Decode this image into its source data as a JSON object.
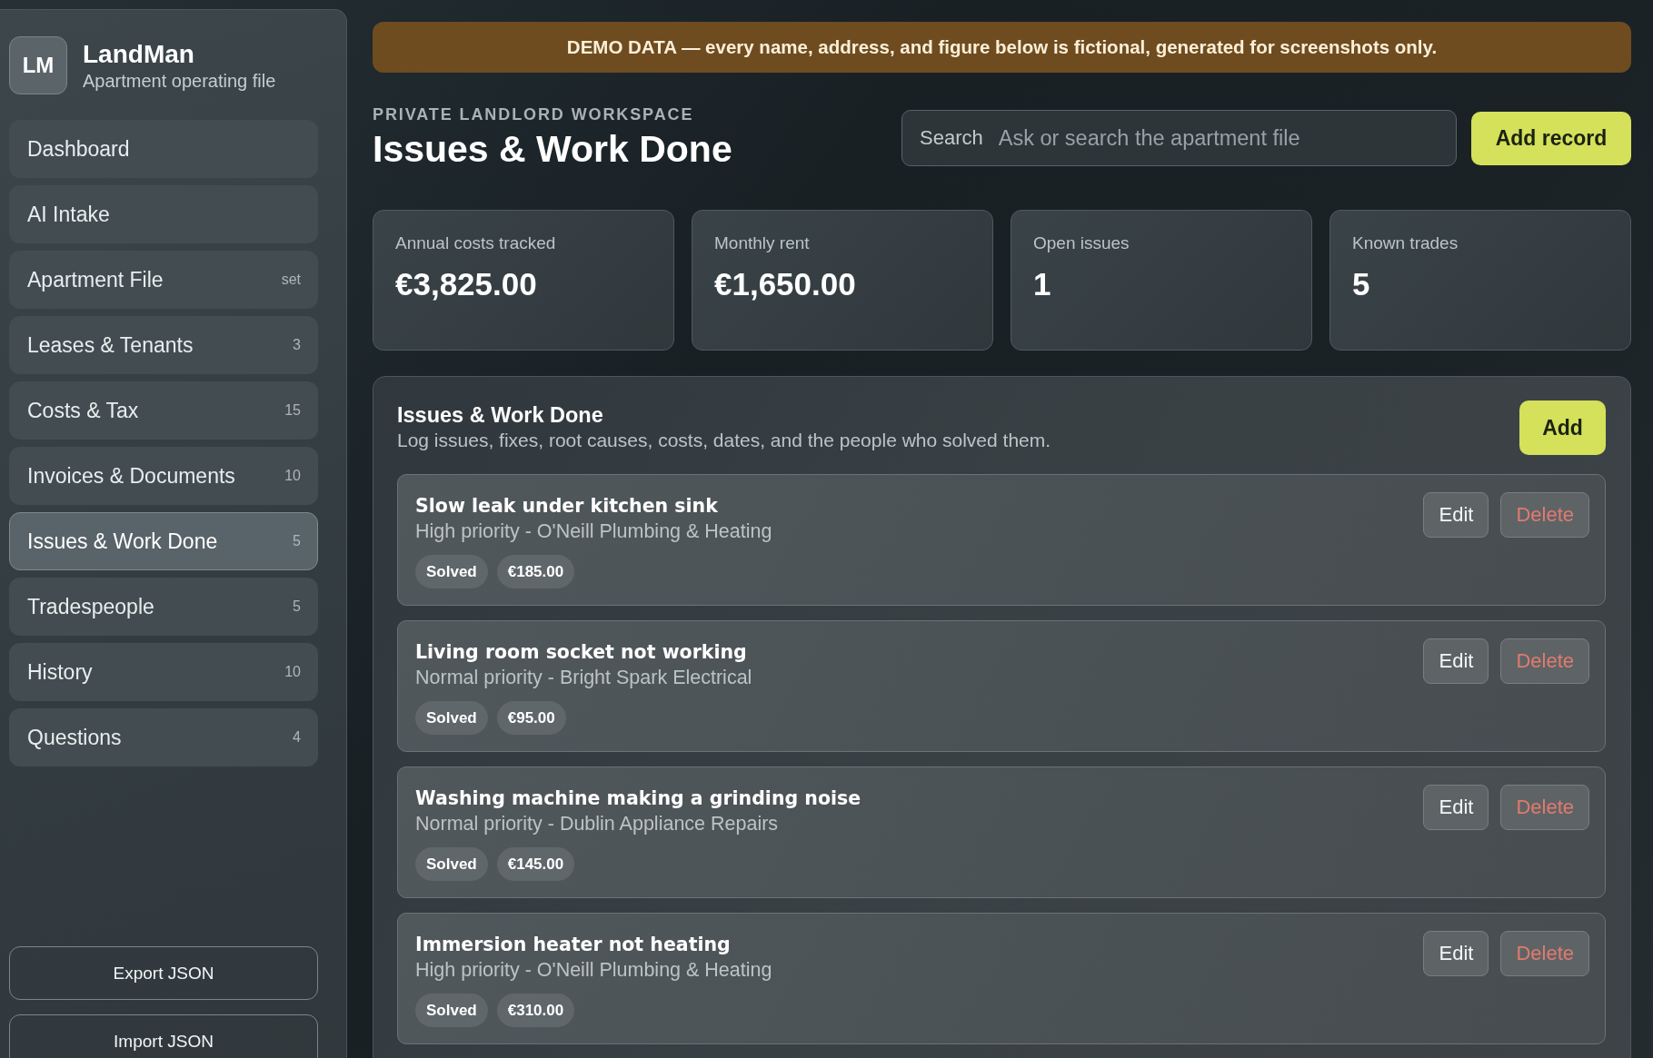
{
  "banner": "DEMO DATA — every name, address, and figure below is fictional, generated for screenshots only.",
  "sidebar": {
    "brand": {
      "logo": "LM",
      "title": "LandMan",
      "subtitle": "Apartment operating file"
    },
    "items": [
      {
        "label": "Dashboard",
        "selected": false
      },
      {
        "label": "AI Intake",
        "selected": false
      },
      {
        "label": "Apartment File",
        "count": "set",
        "selected": false
      },
      {
        "label": "Leases & Tenants",
        "count": "3",
        "selected": false
      },
      {
        "label": "Costs & Tax",
        "count": "15",
        "selected": false
      },
      {
        "label": "Invoices & Documents",
        "count": "10",
        "selected": false
      },
      {
        "label": "Issues & Work Done",
        "count": "5",
        "selected": true
      },
      {
        "label": "Tradespeople",
        "count": "5",
        "selected": false
      },
      {
        "label": "History",
        "count": "10",
        "selected": false
      },
      {
        "label": "Questions",
        "count": "4",
        "selected": false
      }
    ],
    "buttons": [
      "Export JSON",
      "Import JSON"
    ]
  },
  "header": {
    "eyebrow": "PRIVATE LANDLORD WORKSPACE",
    "title": "Issues & Work Done",
    "search": {
      "label": "Search",
      "placeholder": "Ask or search the apartment file"
    },
    "button": "Add record"
  },
  "stats": [
    {
      "label": "Annual costs tracked",
      "value": "€3,825.00"
    },
    {
      "label": "Monthly rent",
      "value": "€1,650.00"
    },
    {
      "label": "Open issues",
      "value": "1"
    },
    {
      "label": "Known trades",
      "value": "5"
    }
  ],
  "panel": {
    "title": "Issues & Work Done",
    "subtitle": "Log issues, fixes, root causes, costs, dates, and the people who solved them.",
    "button": "Add",
    "issues": [
      {
        "title": "Slow leak under kitchen sink",
        "detail": "High priority - O'Neill Plumbing & Heating",
        "status": "Solved",
        "cost": "€185.00",
        "actions": [
          {
            "label": "Edit",
            "kind": "plain"
          },
          {
            "label": "Delete",
            "kind": "danger"
          }
        ]
      },
      {
        "title": "Living room socket not working",
        "detail": "Normal priority - Bright Spark Electrical",
        "status": "Solved",
        "cost": "€95.00",
        "actions": [
          {
            "label": "Edit",
            "kind": "plain"
          },
          {
            "label": "Delete",
            "kind": "danger"
          }
        ]
      },
      {
        "title": "Washing machine making a grinding noise",
        "detail": "Normal priority - Dublin Appliance Repairs",
        "status": "Solved",
        "cost": "€145.00",
        "actions": [
          {
            "label": "Edit",
            "kind": "plain"
          },
          {
            "label": "Delete",
            "kind": "danger"
          }
        ]
      },
      {
        "title": "Immersion heater not heating",
        "detail": "High priority - O'Neill Plumbing & Heating",
        "status": "Solved",
        "cost": "€310.00",
        "actions": [
          {
            "label": "Edit",
            "kind": "plain"
          },
          {
            "label": "Delete",
            "kind": "danger"
          }
        ]
      }
    ]
  }
}
